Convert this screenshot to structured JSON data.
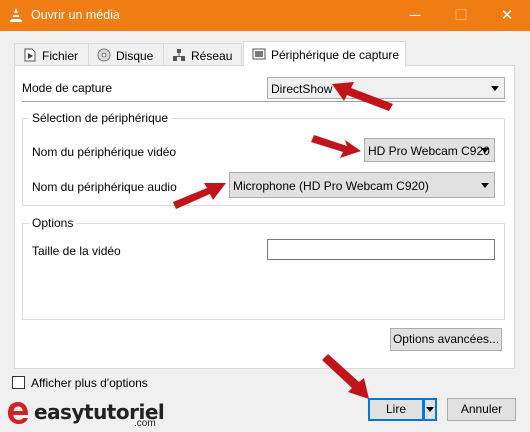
{
  "window": {
    "title": "Ouvrir un média",
    "minimize": "─",
    "maximize": "☐",
    "close": "✕"
  },
  "tabs": [
    {
      "label": "Fichier",
      "icon": "file-icon"
    },
    {
      "label": "Disque",
      "icon": "disc-icon"
    },
    {
      "label": "Réseau",
      "icon": "network-icon"
    },
    {
      "label": "Périphérique de capture",
      "icon": "capture-device-icon",
      "active": true
    }
  ],
  "capture": {
    "mode_label": "Mode de capture",
    "mode_value": "DirectShow"
  },
  "device_group": {
    "title": "Sélection de périphérique",
    "video_label": "Nom du périphérique vidéo",
    "video_value": "HD Pro Webcam C920",
    "audio_label": "Nom du périphérique audio",
    "audio_value": "Microphone (HD Pro Webcam C920)"
  },
  "options_group": {
    "title": "Options",
    "video_size_label": "Taille de la vidéo",
    "video_size_value": ""
  },
  "buttons": {
    "advanced": "Options avancées...",
    "play": "Lire",
    "cancel": "Annuler"
  },
  "show_more": {
    "label": "Afficher plus d'options",
    "checked": false
  },
  "watermark": {
    "brand": "easytutoriel",
    "suffix": ".com"
  },
  "colors": {
    "titlebar": "#ef7d14",
    "annotation_arrow": "#c0141a"
  }
}
